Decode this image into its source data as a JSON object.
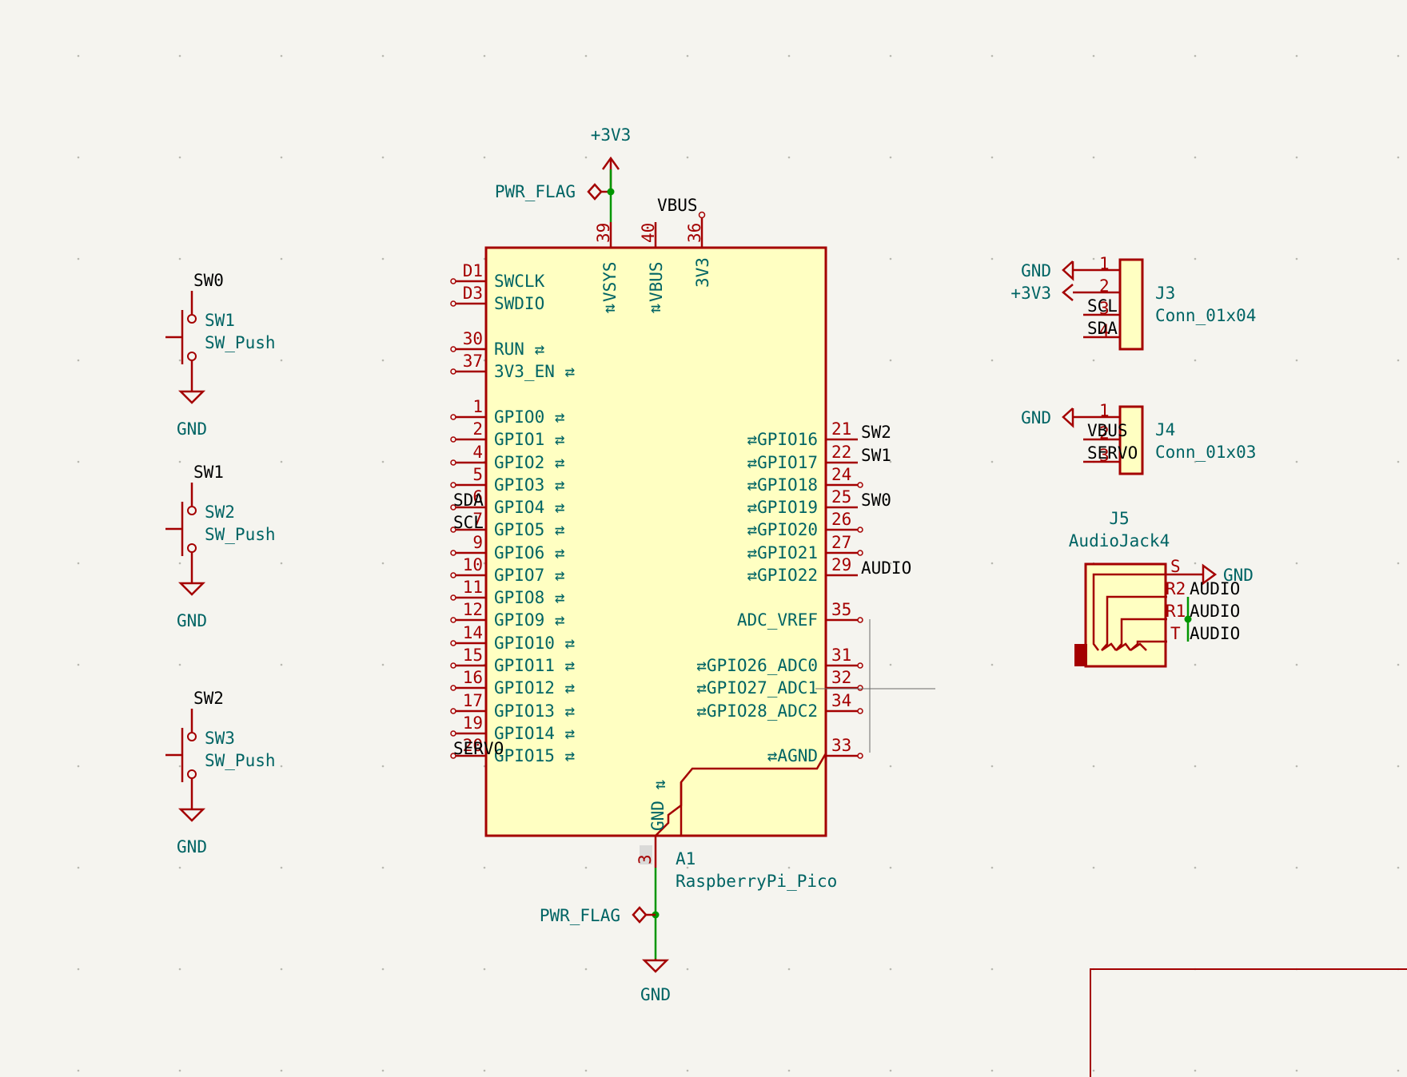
{
  "power_symbols": {
    "v3v3_top": "+3V3",
    "pwr_flag_top": "PWR_FLAG",
    "vbus_top": "VBUS",
    "pwr_flag_bottom": "PWR_FLAG",
    "gnd": "GND",
    "j3_gnd": "GND",
    "j3_3v3": "+3V3",
    "j4_gnd": "GND",
    "j5_gnd": "GND"
  },
  "switches": [
    {
      "net": "SW0",
      "ref": "SW1",
      "value": "SW_Push",
      "gnd": "GND"
    },
    {
      "net": "SW1",
      "ref": "SW2",
      "value": "SW_Push",
      "gnd": "GND"
    },
    {
      "net": "SW2",
      "ref": "SW3",
      "value": "SW_Push",
      "gnd": "GND"
    }
  ],
  "pico": {
    "ref": "A1",
    "value": "RaspberryPi_Pico",
    "top_pins": [
      {
        "num": "39",
        "name": "VSYS"
      },
      {
        "num": "40",
        "name": "VBUS"
      },
      {
        "num": "36",
        "name": "3V3"
      }
    ],
    "left_pins": [
      {
        "num": "D1",
        "name": "SWCLK",
        "net": ""
      },
      {
        "num": "D3",
        "name": "SWDIO",
        "net": ""
      },
      {
        "num": "30",
        "name": "RUN",
        "net": ""
      },
      {
        "num": "37",
        "name": "3V3_EN",
        "net": ""
      },
      {
        "num": "1",
        "name": "GPIO0",
        "net": ""
      },
      {
        "num": "2",
        "name": "GPIO1",
        "net": ""
      },
      {
        "num": "4",
        "name": "GPIO2",
        "net": ""
      },
      {
        "num": "5",
        "name": "GPIO3",
        "net": ""
      },
      {
        "num": "6",
        "name": "GPIO4",
        "net": "SDA"
      },
      {
        "num": "7",
        "name": "GPIO5",
        "net": "SCL"
      },
      {
        "num": "9",
        "name": "GPIO6",
        "net": ""
      },
      {
        "num": "10",
        "name": "GPIO7",
        "net": ""
      },
      {
        "num": "11",
        "name": "GPIO8",
        "net": ""
      },
      {
        "num": "12",
        "name": "GPIO9",
        "net": ""
      },
      {
        "num": "14",
        "name": "GPIO10",
        "net": ""
      },
      {
        "num": "15",
        "name": "GPIO11",
        "net": ""
      },
      {
        "num": "16",
        "name": "GPIO12",
        "net": ""
      },
      {
        "num": "17",
        "name": "GPIO13",
        "net": ""
      },
      {
        "num": "19",
        "name": "GPIO14",
        "net": ""
      },
      {
        "num": "20",
        "name": "GPIO15",
        "net": "SERVO"
      }
    ],
    "right_pins": [
      {
        "num": "21",
        "name": "GPIO16",
        "net": "SW2"
      },
      {
        "num": "22",
        "name": "GPIO17",
        "net": "SW1"
      },
      {
        "num": "24",
        "name": "GPIO18",
        "net": ""
      },
      {
        "num": "25",
        "name": "GPIO19",
        "net": "SW0"
      },
      {
        "num": "26",
        "name": "GPIO20",
        "net": ""
      },
      {
        "num": "27",
        "name": "GPIO21",
        "net": ""
      },
      {
        "num": "29",
        "name": "GPIO22",
        "net": "AUDIO"
      },
      {
        "num": "35",
        "name": "ADC_VREF",
        "net": ""
      },
      {
        "num": "31",
        "name": "GPIO26_ADC0",
        "net": ""
      },
      {
        "num": "32",
        "name": "GPIO27_ADC1",
        "net": ""
      },
      {
        "num": "34",
        "name": "GPIO28_ADC2",
        "net": ""
      },
      {
        "num": "33",
        "name": "AGND",
        "net": ""
      }
    ],
    "bottom_pin": {
      "num": "3",
      "name": "GND"
    }
  },
  "j3": {
    "ref": "J3",
    "value": "Conn_01x04",
    "pins": [
      {
        "num": "1",
        "net": ""
      },
      {
        "num": "2",
        "net": ""
      },
      {
        "num": "3",
        "net": "SCL"
      },
      {
        "num": "4",
        "net": "SDA"
      }
    ]
  },
  "j4": {
    "ref": "J4",
    "value": "Conn_01x03",
    "pins": [
      {
        "num": "1",
        "net": ""
      },
      {
        "num": "2",
        "net": "VBUS"
      },
      {
        "num": "3",
        "net": "SERVO"
      }
    ]
  },
  "j5": {
    "ref": "J5",
    "value": "AudioJack4",
    "pins": [
      {
        "name": "S",
        "net": ""
      },
      {
        "name": "R2",
        "net": "AUDIO"
      },
      {
        "name": "R1",
        "net": "AUDIO"
      },
      {
        "name": "T",
        "net": "AUDIO"
      }
    ]
  },
  "colors": {
    "background": "#f5f4ef",
    "symbol_line": "#a40000",
    "symbol_fill": "#ffffc2",
    "pin_text": "#006464",
    "wire": "#009600",
    "junction": "#009600",
    "net_label": "#000000"
  }
}
